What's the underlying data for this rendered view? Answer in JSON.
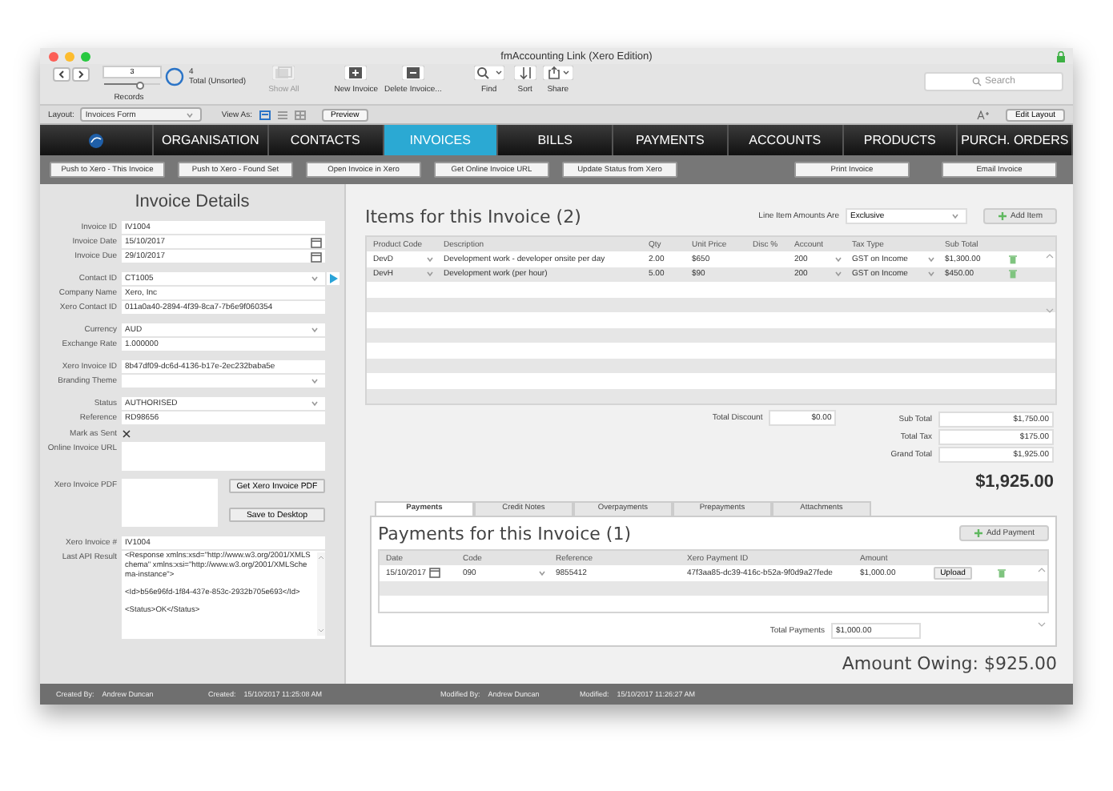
{
  "window": {
    "title": "fmAccounting Link (Xero Edition)"
  },
  "toolbar": {
    "record_number": "3",
    "record_slider": {
      "level": 0.66
    },
    "records_label": "Records",
    "found_count": "4",
    "found_label": "Total (Unsorted)",
    "search": {
      "placeholder": "Search"
    },
    "buttons": [
      {
        "kind": "showall",
        "label": "Show All",
        "disabled": true
      },
      {
        "kind": "new",
        "label": "New Invoice",
        "disabled": false
      },
      {
        "kind": "delete",
        "label": "Delete Invoice...",
        "disabled": false
      },
      {
        "kind": "find",
        "label": "Find",
        "disabled": false
      },
      {
        "kind": "sort",
        "label": "Sort",
        "disabled": false
      },
      {
        "kind": "share",
        "label": "Share",
        "disabled": false
      }
    ]
  },
  "layout_bar": {
    "layout_label": "Layout:",
    "layout_value": "Invoices Form",
    "view_as_label": "View As:",
    "views": [
      {
        "kind": "form",
        "selected": true
      },
      {
        "kind": "list",
        "selected": false
      },
      {
        "kind": "table",
        "selected": false
      }
    ],
    "preview": "Preview",
    "edit_layout": "Edit Layout"
  },
  "nav": [
    {
      "label": "ORGANISATION",
      "selected": false
    },
    {
      "label": "CONTACTS",
      "selected": false
    },
    {
      "label": "INVOICES",
      "selected": true
    },
    {
      "label": "BILLS",
      "selected": false
    },
    {
      "label": "PAYMENTS",
      "selected": false
    },
    {
      "label": "ACCOUNTS",
      "selected": false
    },
    {
      "label": "PRODUCTS",
      "selected": false
    },
    {
      "label": "PURCH. ORDERS",
      "selected": false
    }
  ],
  "actions_left": [
    "Push to Xero - This Invoice",
    "Push to Xero - Found Set",
    "Open Invoice in Xero",
    "Get Online Invoice URL",
    "Update Status from Xero"
  ],
  "actions_right": [
    "Print Invoice",
    "Email Invoice"
  ],
  "invoice_details": {
    "title": "Invoice Details",
    "field_groups": [
      [
        {
          "kind": "text",
          "label": "Invoice ID",
          "value": "IV1004"
        },
        {
          "kind": "date",
          "label": "Invoice Date",
          "value": "15/10/2017"
        },
        {
          "kind": "date",
          "label": "Invoice Due",
          "value": "29/10/2017"
        }
      ],
      [
        {
          "kind": "lookup",
          "label": "Contact ID",
          "value": "CT1005"
        },
        {
          "kind": "text",
          "label": "Company Name",
          "value": "Xero, Inc"
        },
        {
          "kind": "text",
          "label": "Xero Contact ID",
          "value": "011a0a40-2894-4f39-8ca7-7b6e9f060354"
        }
      ],
      [
        {
          "kind": "dropdown",
          "label": "Currency",
          "value": "AUD"
        },
        {
          "kind": "text",
          "label": "Exchange Rate",
          "value": "1.000000"
        }
      ],
      [
        {
          "kind": "text",
          "label": "Xero Invoice ID",
          "value": "8b47df09-dc6d-4136-b17e-2ec232baba5e"
        },
        {
          "kind": "dropdown",
          "label": "Branding Theme"
        }
      ],
      [
        {
          "kind": "dropdown",
          "label": "Status",
          "value": "AUTHORISED"
        },
        {
          "kind": "text",
          "label": "Reference",
          "value": "RD98656"
        },
        {
          "kind": "checkbox",
          "label": "Mark as Sent",
          "checked": true
        },
        {
          "kind": "area",
          "label": "Online Invoice URL"
        },
        {
          "kind": "pdf",
          "label": "Xero Invoice PDF",
          "buttons": [
            "Get Xero Invoice PDF",
            "Save to Desktop"
          ]
        }
      ],
      [
        {
          "kind": "text",
          "label": "Xero Invoice #",
          "value": "IV1004"
        },
        {
          "kind": "api",
          "label": "Last API Result",
          "lines": [
            "<Response xmlns:xsd=\"http://www.w3.org/2001/XMLSchema\" xmlns:xsi=\"http://www.w3.org/2001/XMLSchema-instance\">",
            "<Id>b56e96fd-1f84-437e-853c-2932b705e693</Id>",
            "<Status>OK</Status>"
          ]
        }
      ]
    ]
  },
  "items": {
    "title": "Items for this Invoice (2)",
    "amounts_label": "Line Item Amounts Are",
    "amounts_value": "Exclusive",
    "add_button": "Add Item",
    "columns": [
      {
        "label": "Product Code",
        "kind": "dropdown"
      },
      {
        "label": "Description",
        "kind": "text"
      },
      {
        "label": "Qty",
        "kind": "text"
      },
      {
        "label": "Unit Price",
        "kind": "text"
      },
      {
        "label": "Disc %",
        "kind": "text"
      },
      {
        "label": "Account",
        "kind": "dropdown"
      },
      {
        "label": "Tax Type",
        "kind": "dropdown"
      },
      {
        "label": "Sub Total",
        "kind": "text"
      }
    ],
    "rows": [
      {
        "cells": [
          "DevD",
          "Development work - developer onsite per day",
          "2.00",
          "$650",
          null,
          "200",
          "GST on Income",
          "$1,300.00"
        ]
      },
      {
        "cells": [
          "DevH",
          "Development work (per hour)",
          "5.00",
          "$90",
          null,
          "200",
          "GST on Income",
          "$450.00"
        ]
      }
    ],
    "total_discount_label": "Total Discount",
    "total_discount": "$0.00",
    "totals": [
      {
        "label": "Sub Total",
        "value": "$1,750.00"
      },
      {
        "label": "Total Tax",
        "value": "$175.00"
      },
      {
        "label": "Grand Total",
        "value": "$1,925.00"
      }
    ],
    "grand_total_big": "$1,925.00"
  },
  "payments": {
    "tabs": [
      {
        "label": "Payments",
        "selected": true
      },
      {
        "label": "Credit Notes",
        "selected": false
      },
      {
        "label": "Overpayments",
        "selected": false
      },
      {
        "label": "Prepayments",
        "selected": false
      },
      {
        "label": "Attachments",
        "selected": false
      }
    ],
    "title": "Payments for this Invoice (1)",
    "add_button": "Add Payment",
    "columns": [
      {
        "label": "Date",
        "kind": "date"
      },
      {
        "label": "Code",
        "kind": "dropdown"
      },
      {
        "label": "Reference",
        "kind": "text"
      },
      {
        "label": "Xero Payment ID",
        "kind": "text"
      },
      {
        "label": "Amount",
        "kind": "text"
      }
    ],
    "rows": [
      {
        "cells": [
          "15/10/2017",
          "090",
          "9855412",
          "47f3aa85-dc39-416c-b52a-9f0d9a27fede",
          "$1,000.00"
        ],
        "upload": "Upload"
      }
    ],
    "total_label": "Total Payments",
    "total": "$1,000.00",
    "amount_owing": "Amount Owing: $925.00"
  },
  "footer": [
    {
      "label": "Created By:",
      "value": "Andrew Duncan"
    },
    {
      "label": "Created:",
      "value": "15/10/2017 11:25:08 AM"
    },
    {
      "label": "Modified By:",
      "value": "Andrew Duncan"
    },
    {
      "label": "Modified:",
      "value": "15/10/2017 11:26:27 AM"
    }
  ]
}
